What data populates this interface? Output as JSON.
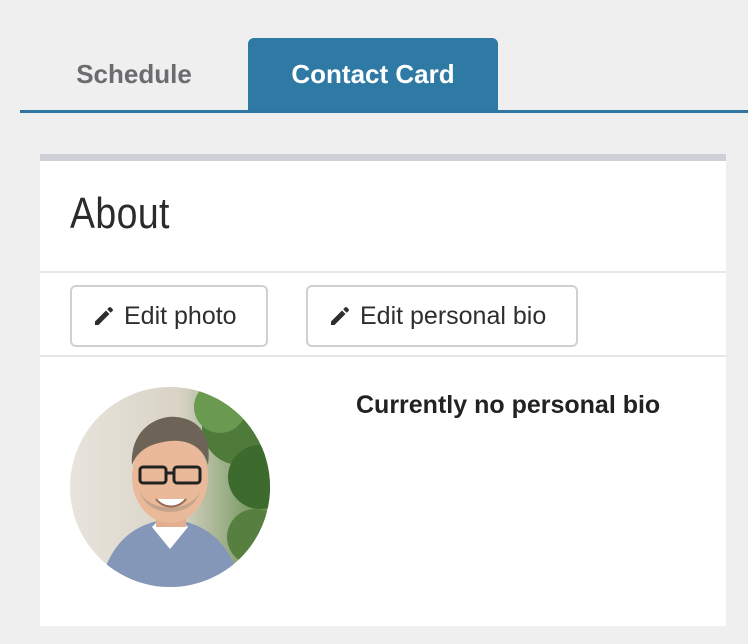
{
  "tabs": [
    {
      "label": "Schedule",
      "active": false
    },
    {
      "label": "Contact Card",
      "active": true
    }
  ],
  "card": {
    "title": "About",
    "buttons": {
      "edit_photo": "Edit photo",
      "edit_bio": "Edit personal bio"
    },
    "bio_status": "Currently no personal bio"
  },
  "colors": {
    "accent": "#2f7aa5",
    "tab_inactive_text": "#6b6b70",
    "page_background": "#efefef",
    "card_top_border": "#cfd0d5"
  },
  "icons": {
    "edit": "pencil-icon",
    "avatar": "profile-photo"
  }
}
